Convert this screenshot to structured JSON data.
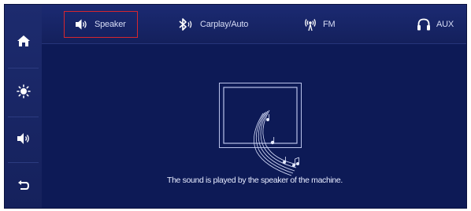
{
  "sidebar": {
    "items": [
      {
        "icon": "home-icon"
      },
      {
        "icon": "brightness-icon"
      },
      {
        "icon": "volume-icon"
      },
      {
        "icon": "back-icon"
      }
    ]
  },
  "tabs": [
    {
      "label": "Speaker",
      "icon": "speaker-icon",
      "active": true
    },
    {
      "label": "Carplay/Auto",
      "icon": "bluetooth-icon",
      "active": false
    },
    {
      "label": "FM",
      "icon": "radio-icon",
      "active": false
    },
    {
      "label": "AUX",
      "icon": "headphones-icon",
      "active": false
    }
  ],
  "main": {
    "caption": "The sound is played by the speaker of the machine."
  },
  "colors": {
    "background": "#0d1a56",
    "tabbar": "#1b2a72",
    "active_outline": "#d7262e",
    "text": "#e6ebff"
  }
}
